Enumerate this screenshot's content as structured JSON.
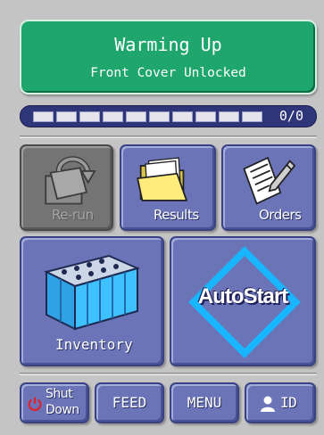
{
  "status": {
    "title": "Warming Up",
    "subtitle": "Front Cover Unlocked",
    "color": "#1fa66d"
  },
  "progress": {
    "count_label": "0/0",
    "fraction": 0,
    "segments_total": 10
  },
  "buttons": {
    "rerun": {
      "label": "Re-run",
      "icon": "rerun-folder-icon",
      "enabled": false
    },
    "results": {
      "label": "Results",
      "icon": "folder-icon"
    },
    "orders": {
      "label": "Orders",
      "icon": "pencil-paper-icon"
    },
    "inventory": {
      "label": "Inventory",
      "icon": "reagent-tubes-icon"
    },
    "autostart": {
      "label": "AutoStart",
      "icon": "diamond-icon"
    }
  },
  "bottom_bar": {
    "shutdown": {
      "line1": "Shut",
      "line2": "Down",
      "icon": "power-icon",
      "icon_color": "#e0202a"
    },
    "feed": {
      "label": "FEED"
    },
    "menu": {
      "label": "MENU"
    },
    "id": {
      "label": "ID",
      "icon": "user-icon"
    }
  },
  "colors": {
    "button_blue": "#6a74b6",
    "progress_track": "#2e3579",
    "autostart_diamond": "#17b6ff"
  }
}
